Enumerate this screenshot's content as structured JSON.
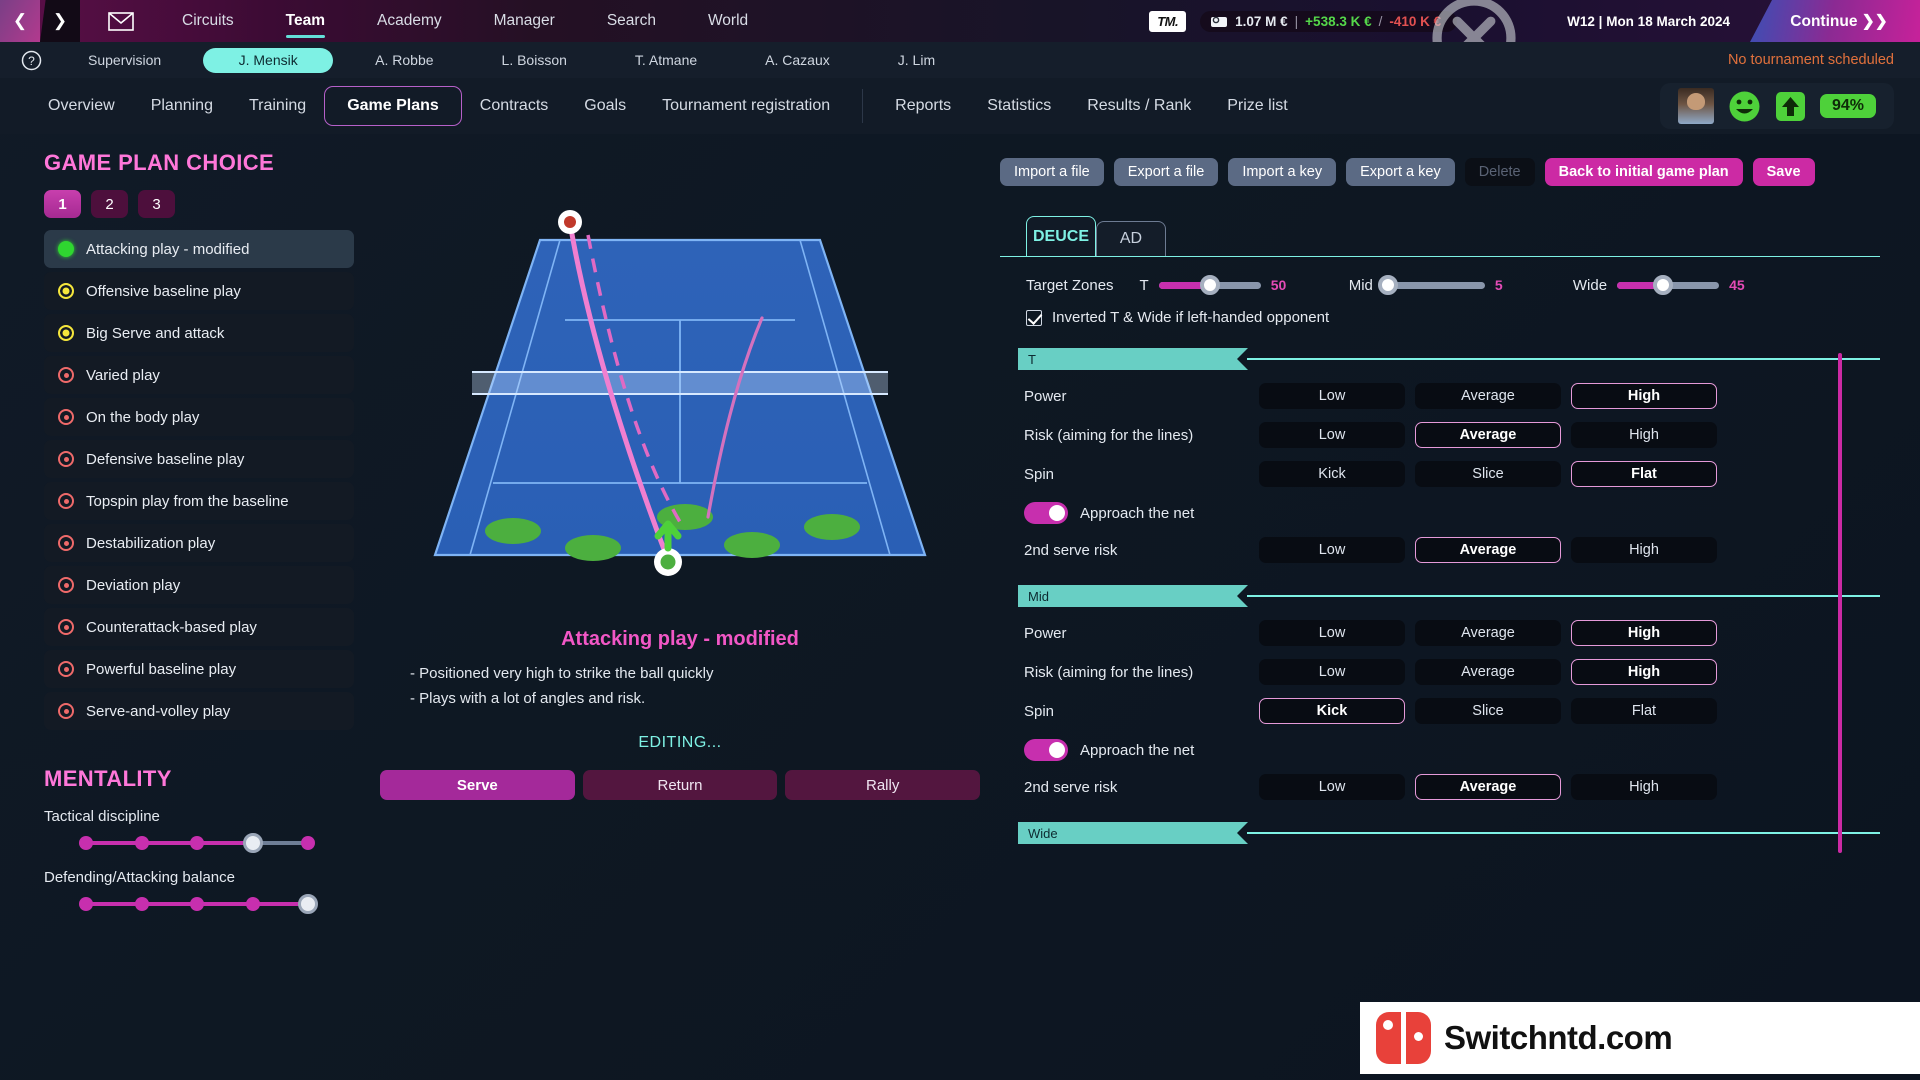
{
  "topbar": {
    "back_arrow": "❮",
    "forward_arrow": "❯",
    "mail_icon": "mail-icon",
    "nav": [
      {
        "label": "Circuits",
        "active": false
      },
      {
        "label": "Team",
        "active": true
      },
      {
        "label": "Academy",
        "active": false
      },
      {
        "label": "Manager",
        "active": false
      },
      {
        "label": "Search",
        "active": false
      },
      {
        "label": "World",
        "active": false
      }
    ],
    "tm_logo": "TM.",
    "money_total": "1.07 M €",
    "money_sep": "|",
    "money_income": "+538.3 K €",
    "money_slash": "/",
    "money_expense": "-410 K €",
    "date": "W12 | Mon 18 March 2024",
    "continue_label": "Continue ❯❯"
  },
  "playerbar": {
    "help": "?",
    "tabs": [
      {
        "label": "Supervision",
        "active": false
      },
      {
        "label": "J. Mensik",
        "active": true
      },
      {
        "label": "A. Robbe",
        "active": false
      },
      {
        "label": "L. Boisson",
        "active": false
      },
      {
        "label": "T. Atmane",
        "active": false
      },
      {
        "label": "A. Cazaux",
        "active": false
      },
      {
        "label": "J. Lim",
        "active": false
      }
    ],
    "notice": "No tournament scheduled"
  },
  "sectionbar": {
    "tabs": [
      {
        "label": "Overview",
        "active": false,
        "divider_after": false
      },
      {
        "label": "Planning",
        "active": false,
        "divider_after": false
      },
      {
        "label": "Training",
        "active": false,
        "divider_after": false
      },
      {
        "label": "Game Plans",
        "active": true,
        "divider_after": false
      },
      {
        "label": "Contracts",
        "active": false,
        "divider_after": false
      },
      {
        "label": "Goals",
        "active": false,
        "divider_after": false
      },
      {
        "label": "Tournament registration",
        "active": false,
        "divider_after": true
      },
      {
        "label": "Reports",
        "active": false,
        "divider_after": false
      },
      {
        "label": "Statistics",
        "active": false,
        "divider_after": false
      },
      {
        "label": "Results / Rank",
        "active": false,
        "divider_after": false
      },
      {
        "label": "Prize list",
        "active": false,
        "divider_after": false
      }
    ],
    "hud": {
      "avatar": "player-avatar",
      "mood_icon": "smiley-happy-icon",
      "form_icon": "up-arrow-icon",
      "condition": "94%"
    }
  },
  "gameplan": {
    "title": "GAME PLAN CHOICE",
    "slots": [
      {
        "label": "1",
        "active": true
      },
      {
        "label": "2",
        "active": false
      },
      {
        "label": "3",
        "active": false
      }
    ],
    "plans": [
      {
        "label": "Attacking play - modified",
        "status": "green",
        "selected": true
      },
      {
        "label": "Offensive baseline play",
        "status": "yellow",
        "selected": false
      },
      {
        "label": "Big Serve and attack",
        "status": "yellow",
        "selected": false
      },
      {
        "label": "Varied play",
        "status": "red",
        "selected": false
      },
      {
        "label": "On the body play",
        "status": "red",
        "selected": false
      },
      {
        "label": "Defensive baseline play",
        "status": "red",
        "selected": false
      },
      {
        "label": "Topspin play from the baseline",
        "status": "red",
        "selected": false
      },
      {
        "label": "Destabilization play",
        "status": "red",
        "selected": false
      },
      {
        "label": "Deviation play",
        "status": "red",
        "selected": false
      },
      {
        "label": "Counterattack-based play",
        "status": "red",
        "selected": false
      },
      {
        "label": "Powerful baseline play",
        "status": "red",
        "selected": false
      },
      {
        "label": "Serve-and-volley play",
        "status": "red",
        "selected": false
      }
    ]
  },
  "mentality": {
    "title": "MENTALITY",
    "sliders": [
      {
        "label": "Tactical discipline",
        "value": 4,
        "max": 5
      },
      {
        "label": "Defending/Attacking balance",
        "value": 5,
        "max": 5
      }
    ]
  },
  "center": {
    "court_icon": "tennis-court-diagram",
    "plan_name": "Attacking play - modified",
    "desc_line1": "- Positioned very high to strike the ball quickly",
    "desc_line2": "- Plays with a lot of angles and risk.",
    "editing_status": "EDITING...",
    "phases": [
      {
        "label": "Serve",
        "active": true
      },
      {
        "label": "Return",
        "active": false
      },
      {
        "label": "Rally",
        "active": false
      }
    ]
  },
  "toolbar": {
    "buttons": [
      {
        "label": "Import a file",
        "style": "normal"
      },
      {
        "label": "Export a file",
        "style": "normal"
      },
      {
        "label": "Import a key",
        "style": "normal"
      },
      {
        "label": "Export a key",
        "style": "normal"
      },
      {
        "label": "Delete",
        "style": "disabled"
      },
      {
        "label": "Back to initial game plan",
        "style": "pink"
      },
      {
        "label": "Save",
        "style": "pink"
      }
    ]
  },
  "side_tabs": [
    {
      "label": "DEUCE",
      "active": true
    },
    {
      "label": "AD",
      "active": false
    }
  ],
  "target_zones": {
    "label": "Target Zones",
    "zones": [
      {
        "name": "T",
        "value": 50,
        "pct": 50
      },
      {
        "name": "Mid",
        "value": 5,
        "pct": 5
      },
      {
        "name": "Wide",
        "value": 45,
        "pct": 45
      }
    ],
    "checkbox_label": "Inverted T & Wide if left-handed opponent",
    "checkbox_checked": true
  },
  "zone_sections": [
    {
      "name": "T",
      "rows": [
        {
          "label": "Power",
          "options": [
            "Low",
            "Average",
            "High"
          ],
          "selected": 2
        },
        {
          "label": "Risk (aiming for the lines)",
          "options": [
            "Low",
            "Average",
            "High"
          ],
          "selected": 1
        },
        {
          "label": "Spin",
          "options": [
            "Kick",
            "Slice",
            "Flat"
          ],
          "selected": 2
        }
      ],
      "toggle_label": "Approach the net",
      "toggle_on": true,
      "second_serve": {
        "label": "2nd serve risk",
        "options": [
          "Low",
          "Average",
          "High"
        ],
        "selected": 1
      }
    },
    {
      "name": "Mid",
      "rows": [
        {
          "label": "Power",
          "options": [
            "Low",
            "Average",
            "High"
          ],
          "selected": 2
        },
        {
          "label": "Risk (aiming for the lines)",
          "options": [
            "Low",
            "Average",
            "High"
          ],
          "selected": 2
        },
        {
          "label": "Spin",
          "options": [
            "Kick",
            "Slice",
            "Flat"
          ],
          "selected": 0
        }
      ],
      "toggle_label": "Approach the net",
      "toggle_on": true,
      "second_serve": {
        "label": "2nd serve risk",
        "options": [
          "Low",
          "Average",
          "High"
        ],
        "selected": 1
      }
    },
    {
      "name": "Wide",
      "rows": [],
      "toggle_label": "",
      "toggle_on": false,
      "second_serve": null
    }
  ],
  "watermark": {
    "text": "Switchntd.com",
    "icon": "switch-logo-icon"
  }
}
